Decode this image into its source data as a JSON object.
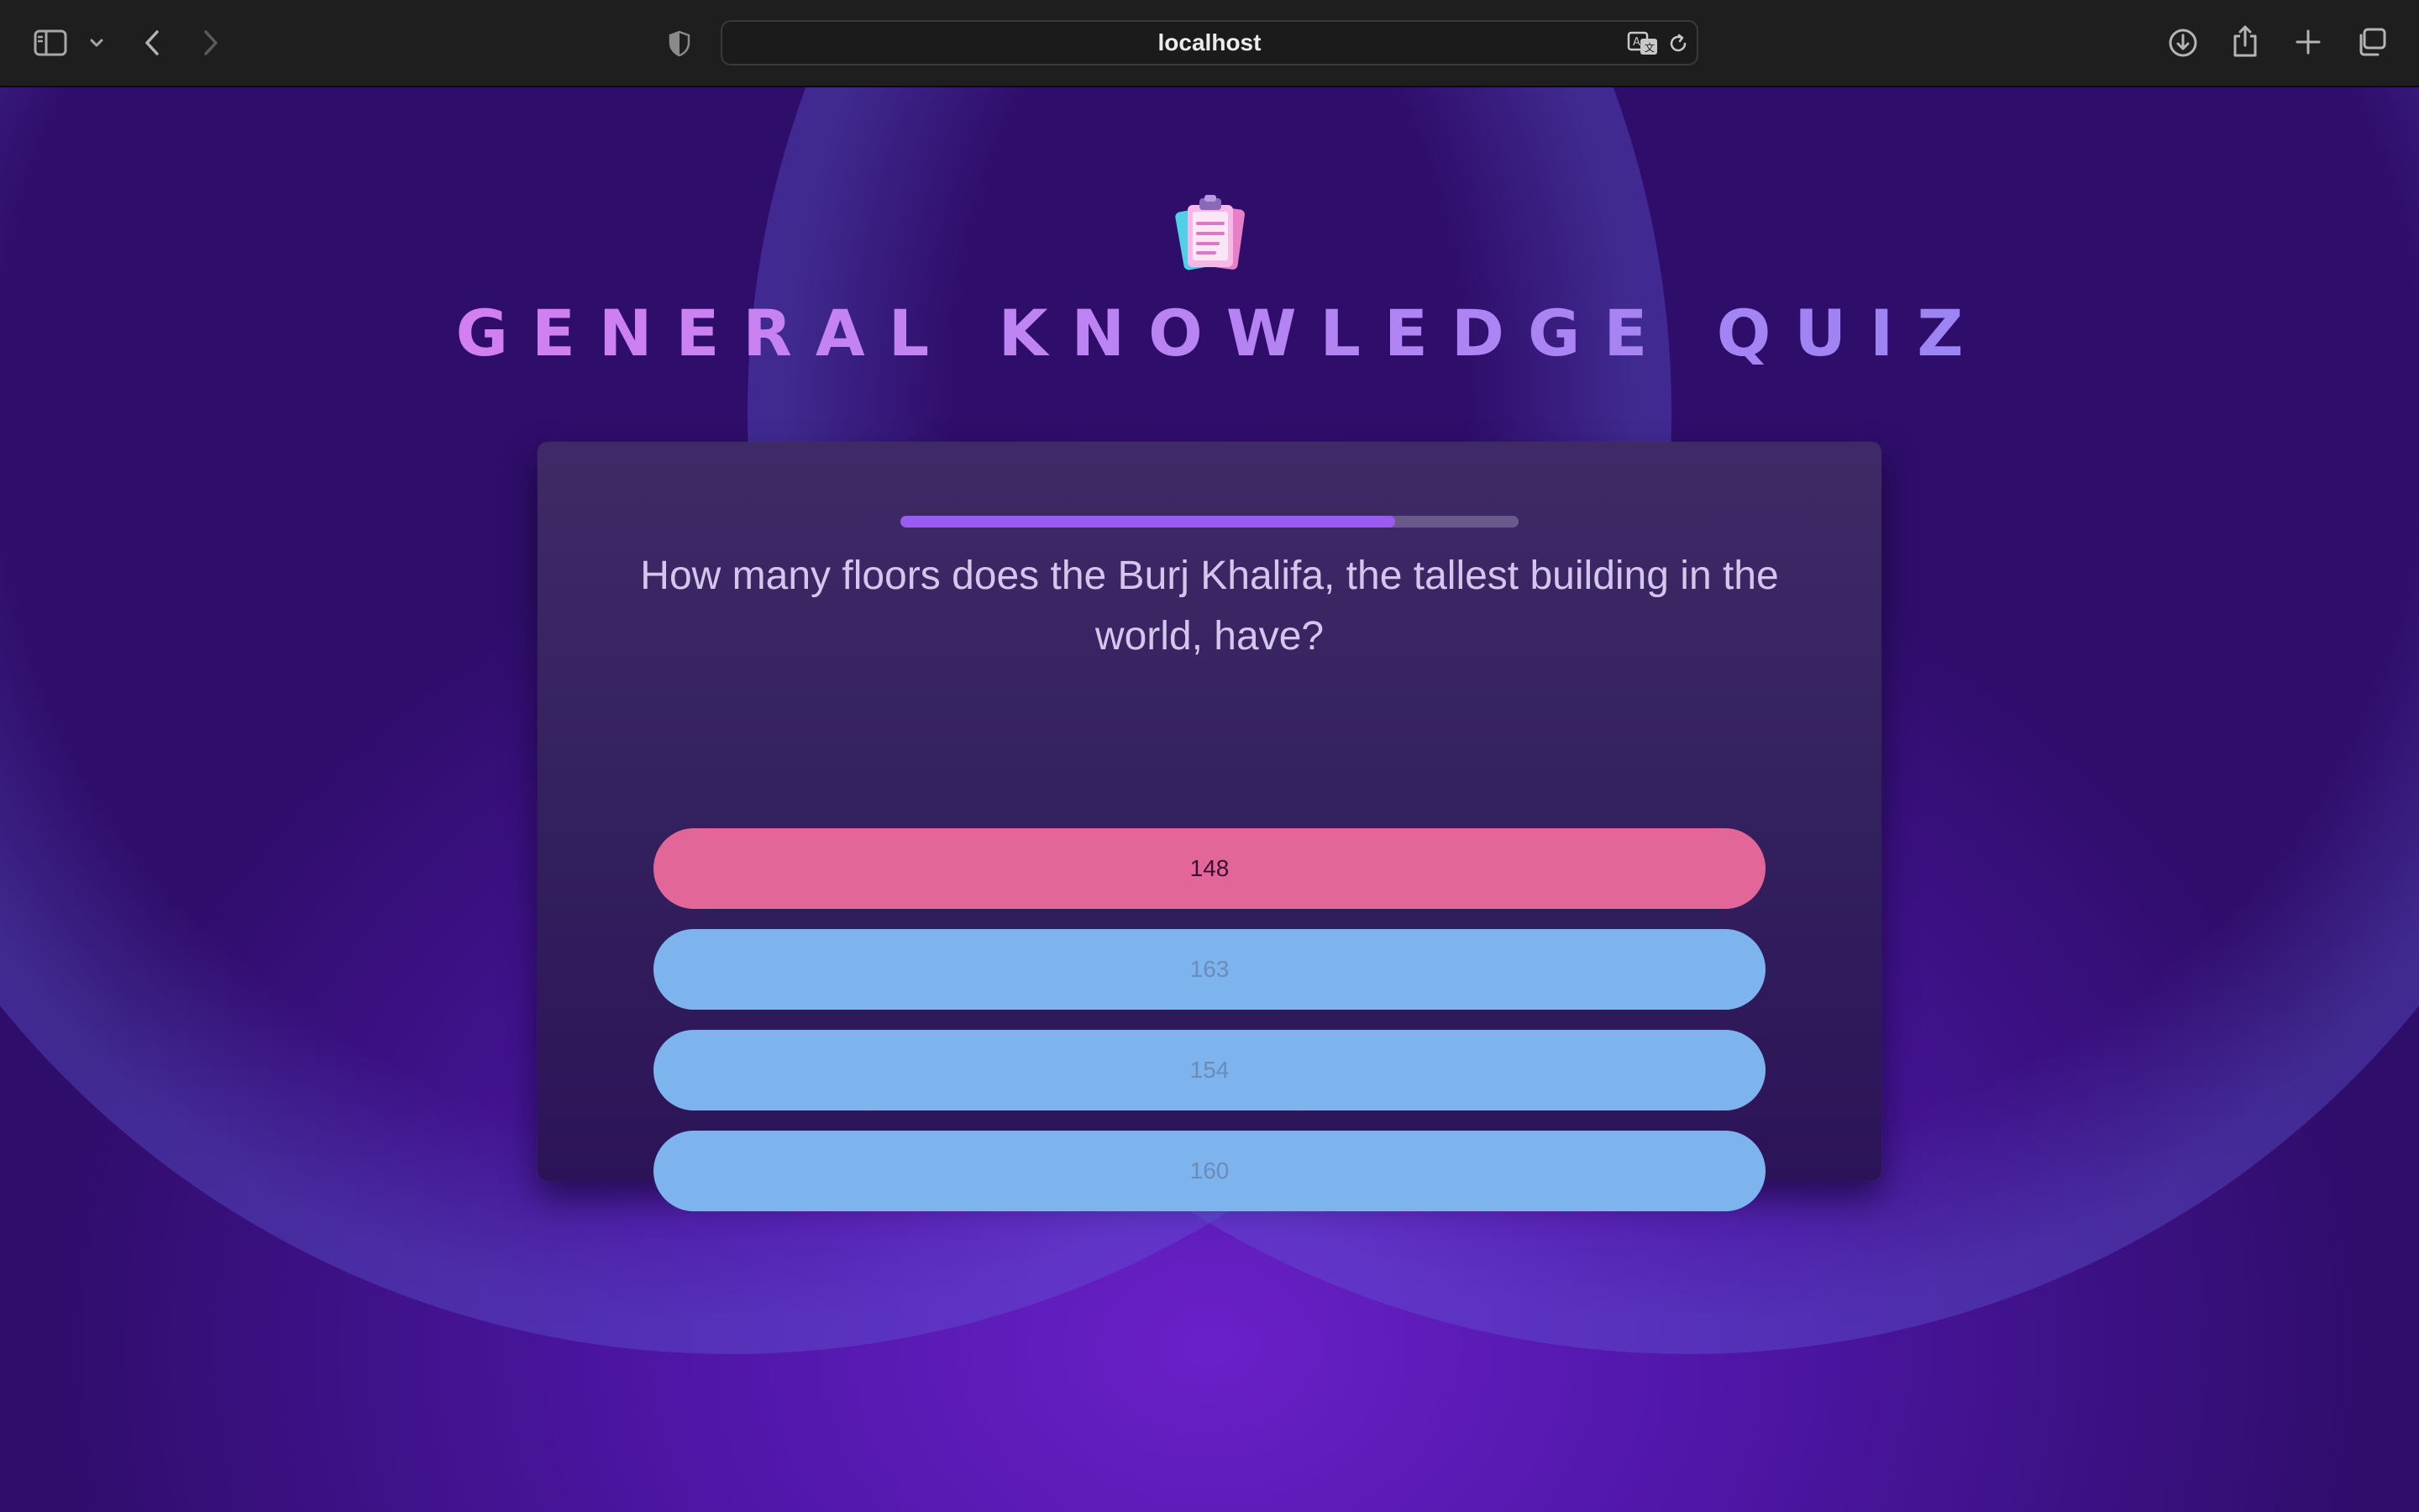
{
  "browser": {
    "url": "localhost",
    "icons": {
      "sidebar": "sidebar-icon",
      "sidebar_menu": "chevron-down-icon",
      "back": "chevron-left-icon",
      "forward": "chevron-right-icon",
      "privacy": "shield-icon",
      "translate": "translate-icon",
      "reload": "reload-icon",
      "downloads": "download-icon",
      "share": "share-icon",
      "new_tab": "plus-icon",
      "tabs": "tabs-overview-icon"
    }
  },
  "quiz": {
    "logo_icon": "clipboard-icon",
    "title": "GENERAL KNOWLEDGE QUIZ",
    "progress_fraction": 0.8,
    "question": "How many floors does the Burj Khalifa, the tallest building in the world, have?",
    "answers": [
      {
        "label": "148",
        "state": "selected"
      },
      {
        "label": "163",
        "state": "other"
      },
      {
        "label": "154",
        "state": "other"
      },
      {
        "label": "160",
        "state": "other"
      }
    ]
  },
  "colors": {
    "background": "#4e16a6",
    "card": "#33215e",
    "progress_fill": "#9a5cf0",
    "answer_selected": "#e36699",
    "answer_default": "#7db4ee",
    "title_gradient_start": "#e27af0",
    "title_gradient_end": "#8a84f4"
  }
}
